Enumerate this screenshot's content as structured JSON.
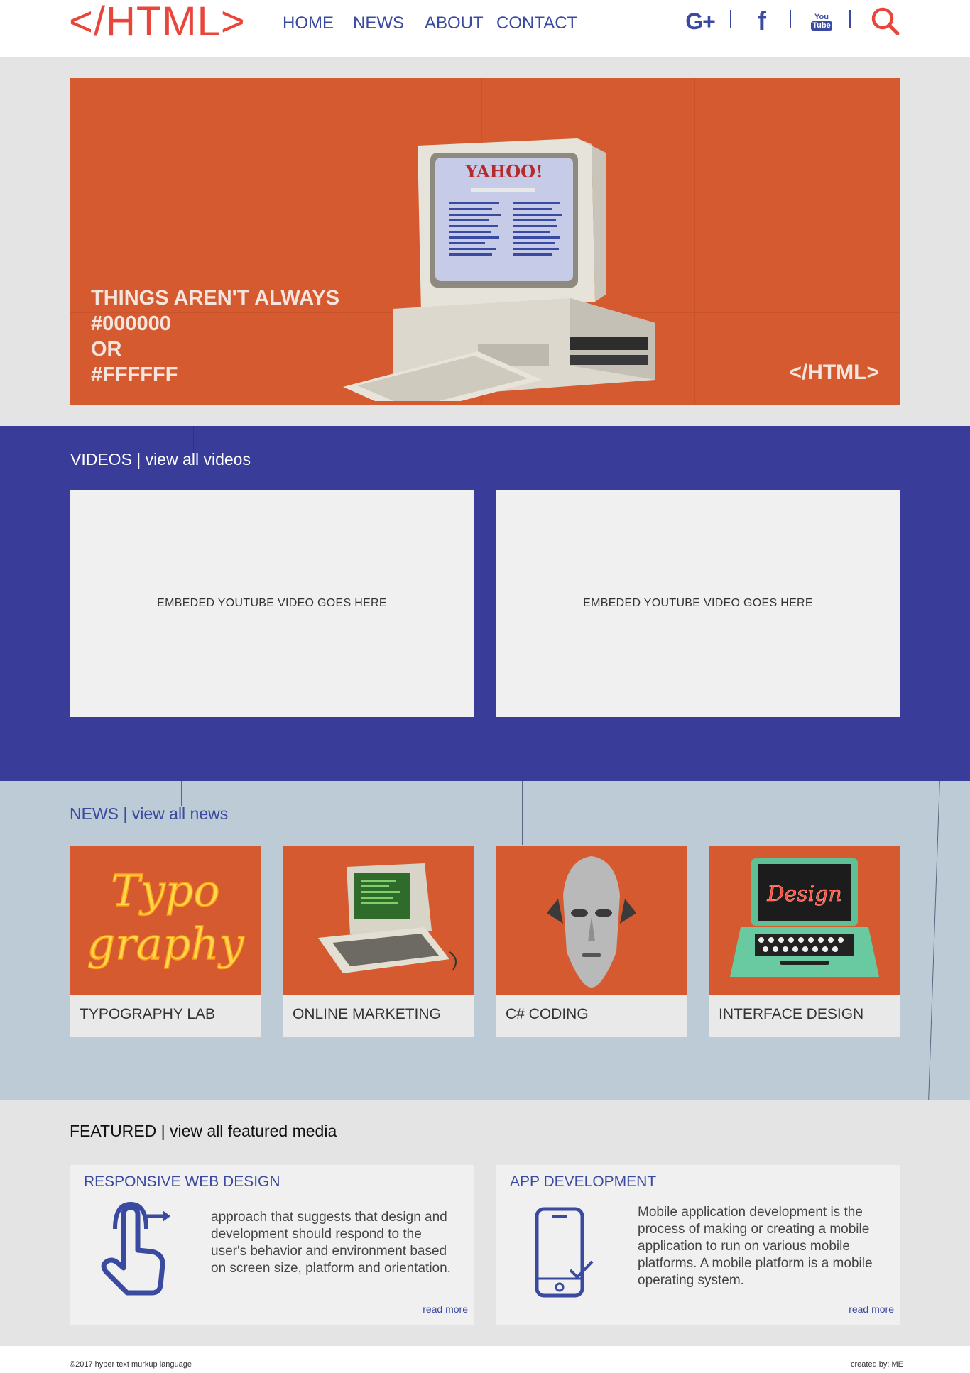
{
  "header": {
    "logo_text": "</HTML>",
    "nav": [
      "HOME",
      "NEWS",
      "ABOUT",
      "CONTACT"
    ],
    "social": {
      "gplus": "G+",
      "facebook": "f",
      "youtube_top": "You",
      "youtube_bottom": "Tube"
    }
  },
  "hero": {
    "lines": [
      "THINGS AREN'T ALWAYS",
      "#000000",
      "OR",
      "#FFFFFF"
    ],
    "mark": "</HTML>",
    "screen_brand": "YAHOO!"
  },
  "videos": {
    "title": "VIDEOS | view all videos",
    "items": [
      "EMBEDED YOUTUBE VIDEO GOES HERE",
      "EMBEDED YOUTUBE VIDEO GOES HERE"
    ]
  },
  "news": {
    "title": "NEWS | view all news",
    "items": [
      {
        "label": "TYPOGRAPHY LAB",
        "img_line1": "Typo",
        "img_line2": "graphy"
      },
      {
        "label": "ONLINE MARKETING"
      },
      {
        "label": "C# CODING"
      },
      {
        "label": "INTERFACE DESIGN",
        "img_text": "Design"
      }
    ]
  },
  "featured": {
    "title": "FEATURED | view all featured media",
    "items": [
      {
        "title": "RESPONSIVE WEB DESIGN",
        "text": "approach that suggests that design and development should respond to the user's behavior and environment based on screen size, platform and orientation.",
        "more": "read more"
      },
      {
        "title": "APP DEVELOPMENT",
        "text": "Mobile application development is the process of making or creating a mobile application to run on various mobile platforms. A mobile platform is a mobile operating system.",
        "more": "read more"
      }
    ]
  },
  "footer": {
    "left": "©2017 hyper text murkup language",
    "right": "created by: ME"
  },
  "colors": {
    "accent_red": "#e8463a",
    "nav_blue": "#3a4aa0",
    "orange": "#d65a2f",
    "videos_bg": "#393d99",
    "news_bg": "#bdcbd6"
  }
}
